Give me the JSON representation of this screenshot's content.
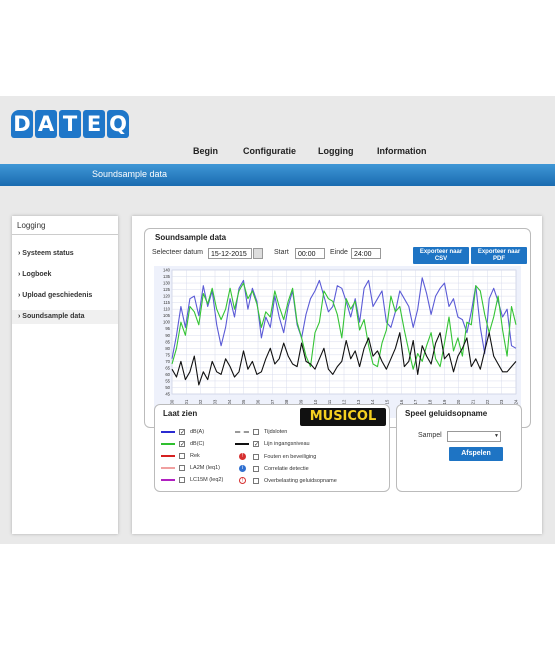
{
  "brand": {
    "logo_letters": [
      "D",
      "A",
      "T",
      "E",
      "Q"
    ]
  },
  "nav": {
    "items": [
      "Begin",
      "Configuratie",
      "Logging",
      "Information"
    ]
  },
  "banner": {
    "title": "Soundsample data"
  },
  "sidebar": {
    "header": "Logging",
    "items": [
      {
        "label": "Systeem status"
      },
      {
        "label": "Logboek"
      },
      {
        "label": "Upload geschiedenis"
      },
      {
        "label": "Soundsample data"
      }
    ]
  },
  "card": {
    "title": "Soundsample data",
    "date_label": "Selecteer datum",
    "date_value": "15-12-2015",
    "start_label": "Start",
    "start_value": "00:00",
    "end_label": "Einde",
    "end_value": "24:00",
    "export_csv": "Exporteer naar CSV",
    "export_pdf": "Exporteer naar PDF"
  },
  "chart_data": {
    "type": "line",
    "ylim": [
      45,
      140
    ],
    "yticks": [
      45,
      50,
      55,
      60,
      65,
      70,
      75,
      80,
      85,
      90,
      95,
      100,
      105,
      110,
      115,
      120,
      125,
      130,
      135,
      140
    ],
    "x": [
      "00",
      "01",
      "02",
      "03",
      "04",
      "05",
      "06",
      "07",
      "08",
      "09",
      "10",
      "11",
      "12",
      "13",
      "14",
      "15",
      "16",
      "17",
      "18",
      "19",
      "20",
      "21",
      "22",
      "23",
      "24"
    ],
    "grid": true,
    "series": [
      {
        "name": "dB(A)",
        "color": "#5b5bd6",
        "values": [
          72,
          90,
          112,
          96,
          118,
          120,
          105,
          128,
          112,
          124,
          98,
          82,
          96,
          118,
          104,
          126,
          132,
          110,
          126,
          116,
          88,
          104,
          96,
          120,
          104,
          92,
          112,
          124,
          98,
          88,
          106,
          118,
          124,
          132,
          120,
          108,
          112,
          128,
          126,
          116,
          104,
          118,
          100,
          126,
          132,
          112,
          118,
          124,
          100,
          96,
          108,
          124,
          118,
          112,
          96,
          110,
          134,
          122,
          106,
          120,
          126,
          130,
          112,
          118,
          104,
          102,
          92,
          108,
          128,
          96,
          76,
          118,
          126,
          116,
          104,
          110,
          82,
          80
        ]
      },
      {
        "name": "dB(C)",
        "color": "#35c435",
        "values": [
          68,
          80,
          100,
          90,
          112,
          108,
          98,
          122,
          114,
          126,
          110,
          102,
          110,
          126,
          110,
          124,
          130,
          118,
          124,
          114,
          96,
          108,
          104,
          124,
          112,
          102,
          116,
          126,
          100,
          88,
          74,
          66,
          92,
          100,
          124,
          118,
          116,
          106,
          88,
          118,
          110,
          116,
          94,
          102,
          82,
          68,
          66,
          84,
          94,
          120,
          108,
          112,
          94,
          78,
          64,
          76,
          70,
          82,
          92,
          72,
          66,
          84,
          104,
          78,
          88,
          74,
          100,
          98,
          128,
          124,
          106,
          92,
          104,
          120,
          94,
          74,
          112,
          98
        ]
      },
      {
        "name": "Lijn ingangsniveau",
        "color": "#111111",
        "values": [
          64,
          58,
          70,
          56,
          62,
          74,
          52,
          62,
          56,
          70,
          62,
          60,
          72,
          66,
          58,
          62,
          78,
          64,
          70,
          60,
          62,
          72,
          80,
          68,
          72,
          84,
          74,
          68,
          66,
          84,
          70,
          68,
          64,
          72,
          80,
          64,
          60,
          66,
          70,
          86,
          72,
          78,
          66,
          80,
          88,
          74,
          78,
          70,
          64,
          72,
          80,
          92,
          66,
          70,
          86,
          60,
          82,
          74,
          68,
          84,
          92,
          72,
          76,
          62,
          74,
          80,
          88,
          66,
          72,
          64,
          78,
          92,
          74,
          68,
          62,
          62,
          66,
          70
        ]
      }
    ]
  },
  "legend": {
    "title": "Laat zien",
    "items": [
      {
        "label": "dB(A)",
        "color": "#2b2bd1",
        "checked": true
      },
      {
        "label": "dB(C)",
        "color": "#2fbf2f",
        "checked": true
      },
      {
        "label": "Rek",
        "color": "#d62020",
        "checked": false
      },
      {
        "label": "LA2M (leq1)",
        "color": "#f0a0a0",
        "checked": false
      },
      {
        "label": "LC15M (leq2)",
        "color": "#b020c0",
        "checked": false
      }
    ],
    "items2": [
      {
        "label": "Tijdsloten",
        "color": "#999999",
        "checked": false
      },
      {
        "label": "Lijn ingangsniveau",
        "color": "#111111",
        "checked": true
      },
      {
        "label": "Fouten en beveiliging",
        "icon_color": "#d63030",
        "checked": false
      },
      {
        "label": "Correlatie detectie",
        "icon_color": "#3070d0",
        "checked": false
      },
      {
        "label": "Overbelasting geluidsopname",
        "icon_color": "#d63030",
        "checked": false
      }
    ]
  },
  "musicol": {
    "logo_text": "MUSICOL"
  },
  "play": {
    "title": "Speel geluidsopname",
    "sample_label": "Sampel",
    "sample_value": "",
    "play_button": "Afspelen"
  }
}
